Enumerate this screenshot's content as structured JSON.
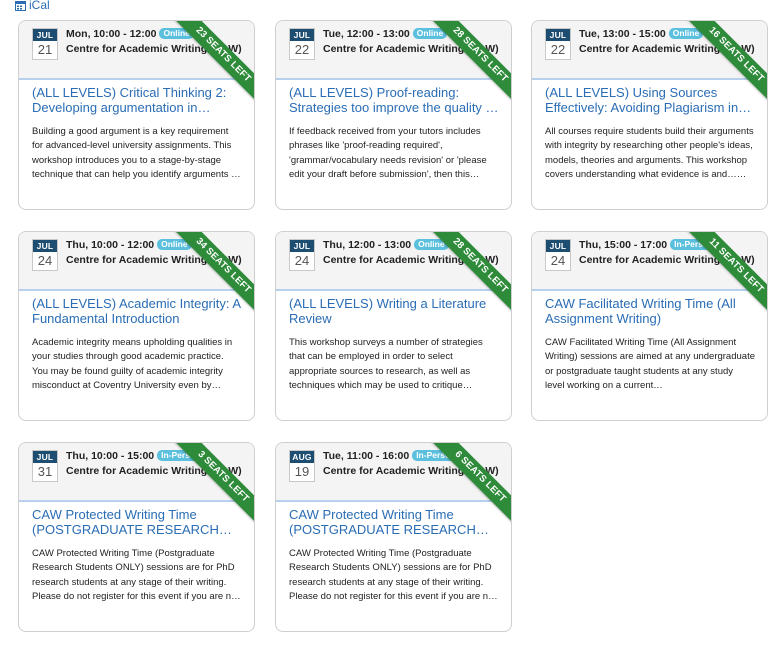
{
  "ical": {
    "label": "iCal"
  },
  "colors": {
    "ribbon": "#2e8b3a",
    "mode_badge": "#5bc0de",
    "month": "#1d4e72",
    "link": "#2a6db5"
  },
  "events": [
    {
      "month": "JUL",
      "day": "21",
      "time": "Mon, 10:00 - 12:00",
      "mode": "Online",
      "organizer": "Centre for Academic Writing (CAW)",
      "seats": "23 SEATS LEFT",
      "title": "(ALL LEVELS) Critical Thinking 2: Developing argumentation in…",
      "description": "Building a good argument is a key requirement for advanced-level university assignments. This workshop introduces you to a stage-by-stage technique that can help you identify arguments …"
    },
    {
      "month": "JUL",
      "day": "22",
      "time": "Tue, 12:00 - 13:00",
      "mode": "Online",
      "organizer": "Centre for Academic Writing (CAW)",
      "seats": "28 SEATS LEFT",
      "title": "(ALL LEVELS) Proof-reading: Strategies too improve the quality …",
      "description": "If feedback received from your tutors includes phrases like 'proof-reading required', 'grammar/vocabulary needs revision' or 'please edit your draft before submission', then this…"
    },
    {
      "month": "JUL",
      "day": "22",
      "time": "Tue, 13:00 - 15:00",
      "mode": "Online",
      "organizer": "Centre for Academic Writing (CAW)",
      "seats": "16 SEATS LEFT",
      "title": "(ALL LEVELS) Using Sources Effectively: Avoiding Plagiarism in…",
      "description": "All courses require students build their arguments with integrity by researching other people's ideas, models, theories and arguments. This workshop covers understanding what evidence is and……"
    },
    {
      "month": "JUL",
      "day": "24",
      "time": "Thu, 10:00 - 12:00",
      "mode": "Online",
      "organizer": "Centre for Academic Writing (CAW)",
      "seats": "34 SEATS LEFT",
      "title": "(ALL LEVELS) Academic Integrity: A Fundamental Introduction",
      "description": "Academic integrity means upholding qualities in your studies through good academic practice. You may be found guilty of academic integrity misconduct at Coventry University even by…"
    },
    {
      "month": "JUL",
      "day": "24",
      "time": "Thu, 12:00 - 13:00",
      "mode": "Online",
      "organizer": "Centre for Academic Writing (CAW)",
      "seats": "28 SEATS LEFT",
      "title": "(ALL LEVELS) Writing a Literature Review",
      "description": "This workshop surveys a number of strategies that can be employed in order to select appropriate sources to research, as well as techniques which may be used to critique…"
    },
    {
      "month": "JUL",
      "day": "24",
      "time": "Thu, 15:00 - 17:00",
      "mode": "In-Person",
      "organizer": "Centre for Academic Writing (CAW)",
      "seats": "11 SEATS LEFT",
      "title": "CAW Facilitated Writing Time (All Assignment Writing)",
      "description": "CAW Facilitated Writing Time (All Assignment Writing) sessions are aimed at any undergraduate or postgraduate taught students at any study level working on a current…"
    },
    {
      "month": "JUL",
      "day": "31",
      "time": "Thu, 10:00 - 15:00",
      "mode": "In-Person",
      "organizer": "Centre for Academic Writing (CAW)",
      "seats": "3 SEATS LEFT",
      "title": "CAW Protected Writing Time (POSTGRADUATE RESEARCH…",
      "description": "CAW Protected Writing Time (Postgraduate Research Students ONLY) sessions are for PhD research students at any stage of their writing. Please do not register for this event if you are n…"
    },
    {
      "month": "AUG",
      "day": "19",
      "time": "Tue, 11:00 - 16:00",
      "mode": "In-Person",
      "organizer": "Centre for Academic Writing (CAW)",
      "seats": "6 SEATS LEFT",
      "title": "CAW Protected Writing Time (POSTGRADUATE RESEARCH…",
      "description": "CAW Protected Writing Time (Postgraduate Research Students ONLY) sessions are for PhD research students at any stage of their writing. Please do not register for this event if you are n…"
    }
  ]
}
